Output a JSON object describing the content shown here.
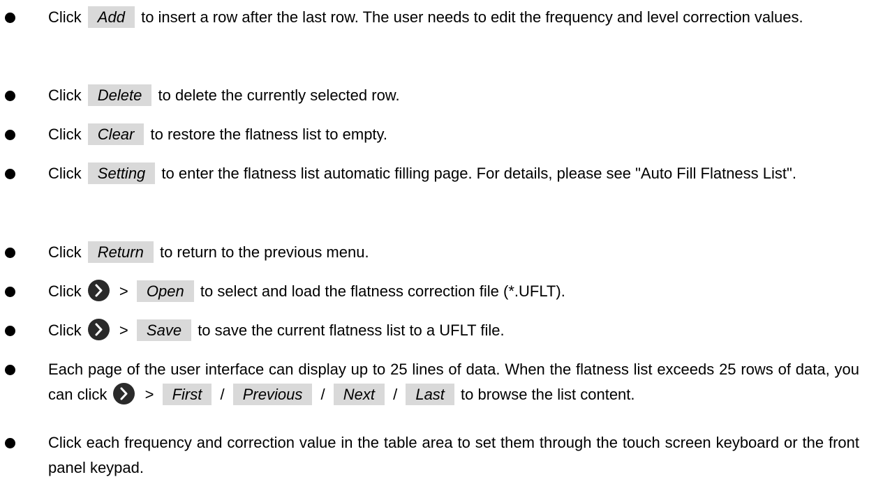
{
  "bullets": [
    {
      "pre": "Click",
      "button": "Add",
      "post": "to insert a row after the last row. The user needs to edit the frequency and level correction values."
    },
    {
      "pre": "Click",
      "button": "Delete",
      "post": "to delete the currently selected row."
    },
    {
      "pre": "Click",
      "button": "Clear",
      "post": "to restore the flatness list to empty."
    },
    {
      "pre": "Click",
      "button": "Setting",
      "post": "to enter the flatness list automatic filling page. For details, please see \"Auto Fill Flatness List\"."
    },
    {
      "pre": "Click",
      "button": "Return",
      "post": "to return to the previous menu."
    },
    {
      "pre": "Click",
      "gt": ">",
      "button": "Open",
      "post": "to select and load the flatness correction file (*.UFLT)."
    },
    {
      "pre": "Click",
      "gt": ">",
      "button": "Save",
      "post": "to save the current flatness list to a UFLT file."
    },
    {
      "pre": "Each page of the user interface can display up to 25 lines of data. When the flatness list exceeds 25 rows of data, you can click",
      "gt": ">",
      "buttons": [
        "First",
        "Previous",
        "Next",
        "Last"
      ],
      "slash": "/",
      "post": "to browse the list content."
    },
    {
      "text": "Click each frequency and correction value in the table area to set them through the touch screen keyboard or the front panel keypad."
    }
  ],
  "icons": {
    "more": "chevron-right-icon"
  },
  "colors": {
    "button_bg": "#d9d9d9",
    "icon_bg": "#2a2a2a",
    "icon_fg": "#ffffff"
  }
}
